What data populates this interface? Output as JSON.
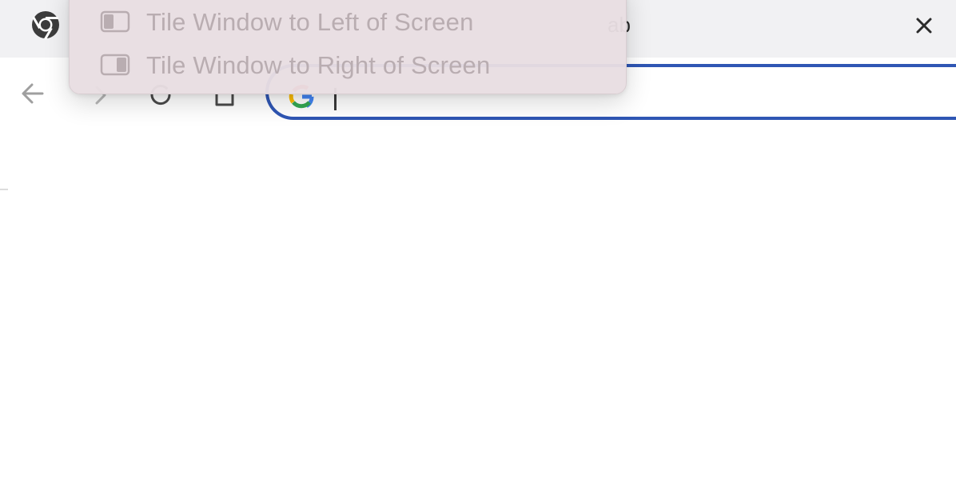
{
  "tab": {
    "title": "ab",
    "close_icon": "close-icon"
  },
  "toolbar": {
    "back_icon": "arrow-left-icon",
    "forward_icon": "arrow-right-icon",
    "reload_icon": "reload-icon",
    "home_icon": "home-icon"
  },
  "omnibox": {
    "value": "",
    "icon": "google-g-icon",
    "focus_color": "#2f56b4"
  },
  "context_menu": {
    "items": [
      {
        "label": "Tile Window to Left of Screen",
        "icon": "tile-left-icon"
      },
      {
        "label": "Tile Window to Right of Screen",
        "icon": "tile-right-icon"
      }
    ],
    "disabled_text_color": "#b9adb1"
  }
}
